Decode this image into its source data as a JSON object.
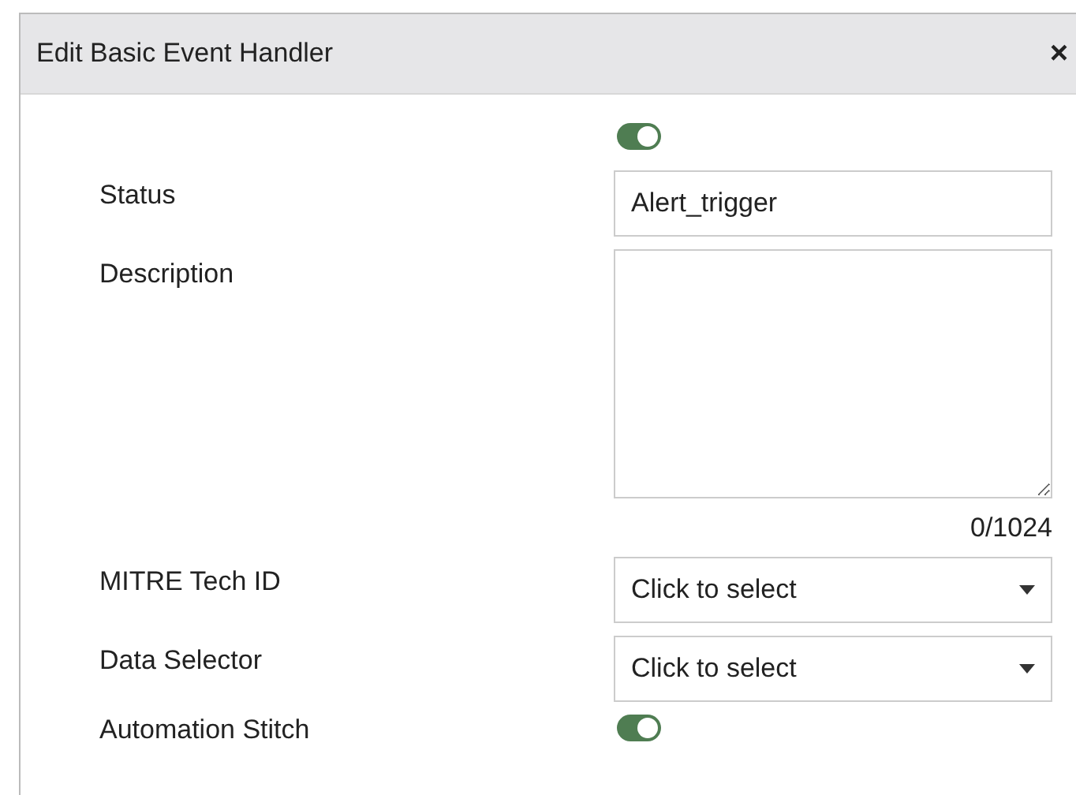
{
  "dialog": {
    "title": "Edit Basic Event Handler",
    "close": "×"
  },
  "rows": [
    {
      "kind": "toggle",
      "on": true
    },
    {
      "kind": "text",
      "label": "Status",
      "value": "Alert_trigger"
    },
    {
      "kind": "textarea",
      "label": "Description",
      "counter": "0/1024"
    },
    {
      "kind": "select",
      "label": "MITRE Tech ID",
      "placeholder": "Click to select"
    },
    {
      "kind": "select",
      "label": "Data Selector",
      "placeholder": "Click to select"
    },
    {
      "kind": "toggle",
      "label": "Automation Stitch",
      "on": true
    }
  ]
}
